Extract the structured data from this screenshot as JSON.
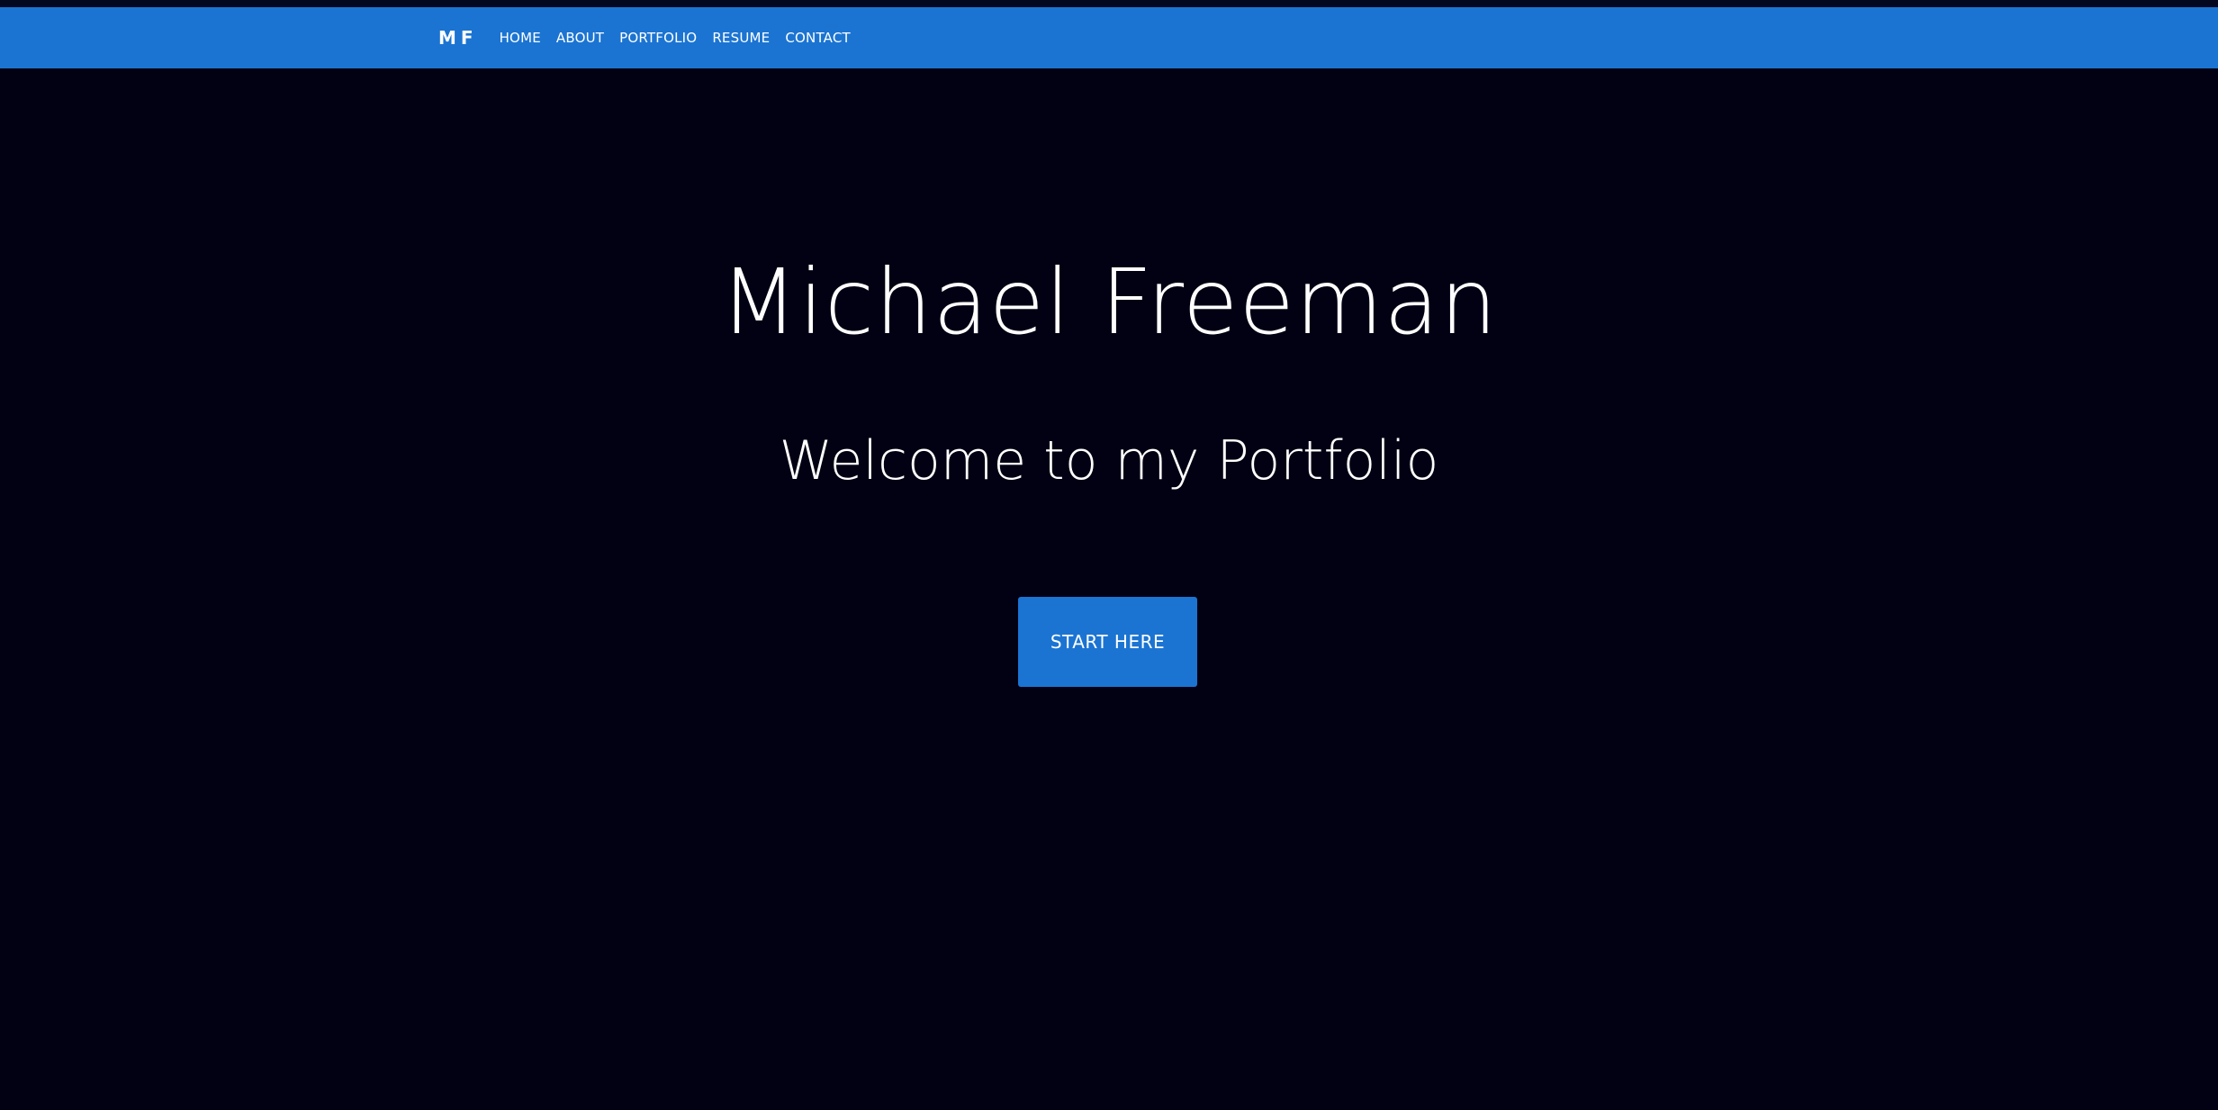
{
  "nav": {
    "brand": "MF",
    "links": [
      {
        "label": "HOME"
      },
      {
        "label": "ABOUT"
      },
      {
        "label": "PORTFOLIO"
      },
      {
        "label": "RESUME"
      },
      {
        "label": "CONTACT"
      }
    ]
  },
  "hero": {
    "title": "Michael Freeman",
    "subtitle": "Welcome to my Portfolio",
    "cta_label": "START HERE"
  },
  "colors": {
    "accent": "#1b74d2",
    "background": "#020113",
    "text": "#ffffff"
  }
}
